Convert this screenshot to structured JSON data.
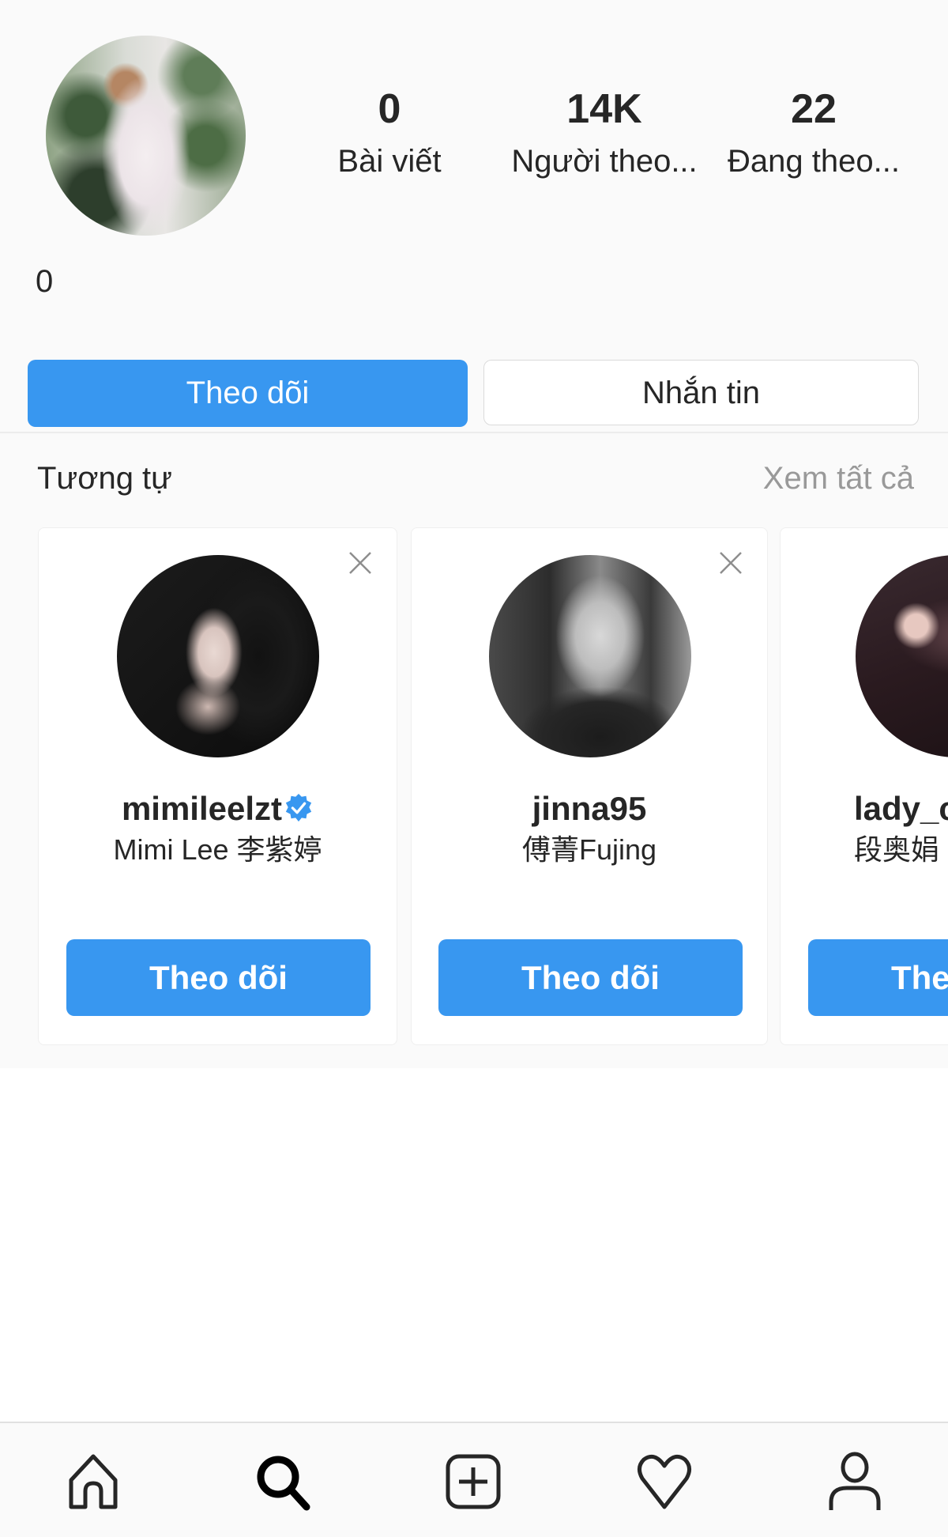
{
  "profile": {
    "stats": [
      {
        "value": "0",
        "label": "Bài viết"
      },
      {
        "value": "14K",
        "label": "Người theo..."
      },
      {
        "value": "22",
        "label": "Đang theo..."
      }
    ],
    "bio": "0",
    "follow_label": "Theo dõi",
    "message_label": "Nhắn tin"
  },
  "suggestions": {
    "title": "Tương tự",
    "see_all": "Xem tất cả",
    "cards": [
      {
        "username": "mimileelzt",
        "verified": true,
        "full_name": "Mimi Lee 李紫婷",
        "button": "Theo dõi"
      },
      {
        "username": "jinna95",
        "verified": false,
        "full_name": "傅菁Fujing",
        "button": "Theo dõi"
      },
      {
        "username": "lady_c",
        "verified": false,
        "full_name": "段奥娟",
        "button": "Theo dõi"
      }
    ]
  },
  "nav": {
    "items": [
      {
        "name": "home",
        "icon": "home-icon"
      },
      {
        "name": "search",
        "icon": "search-icon",
        "active": true
      },
      {
        "name": "add",
        "icon": "add-post-icon"
      },
      {
        "name": "activity",
        "icon": "heart-icon"
      },
      {
        "name": "profile",
        "icon": "profile-icon"
      }
    ]
  },
  "colors": {
    "accent": "#3897f0",
    "text": "#262626",
    "muted": "#999999",
    "background": "#fafafa"
  }
}
